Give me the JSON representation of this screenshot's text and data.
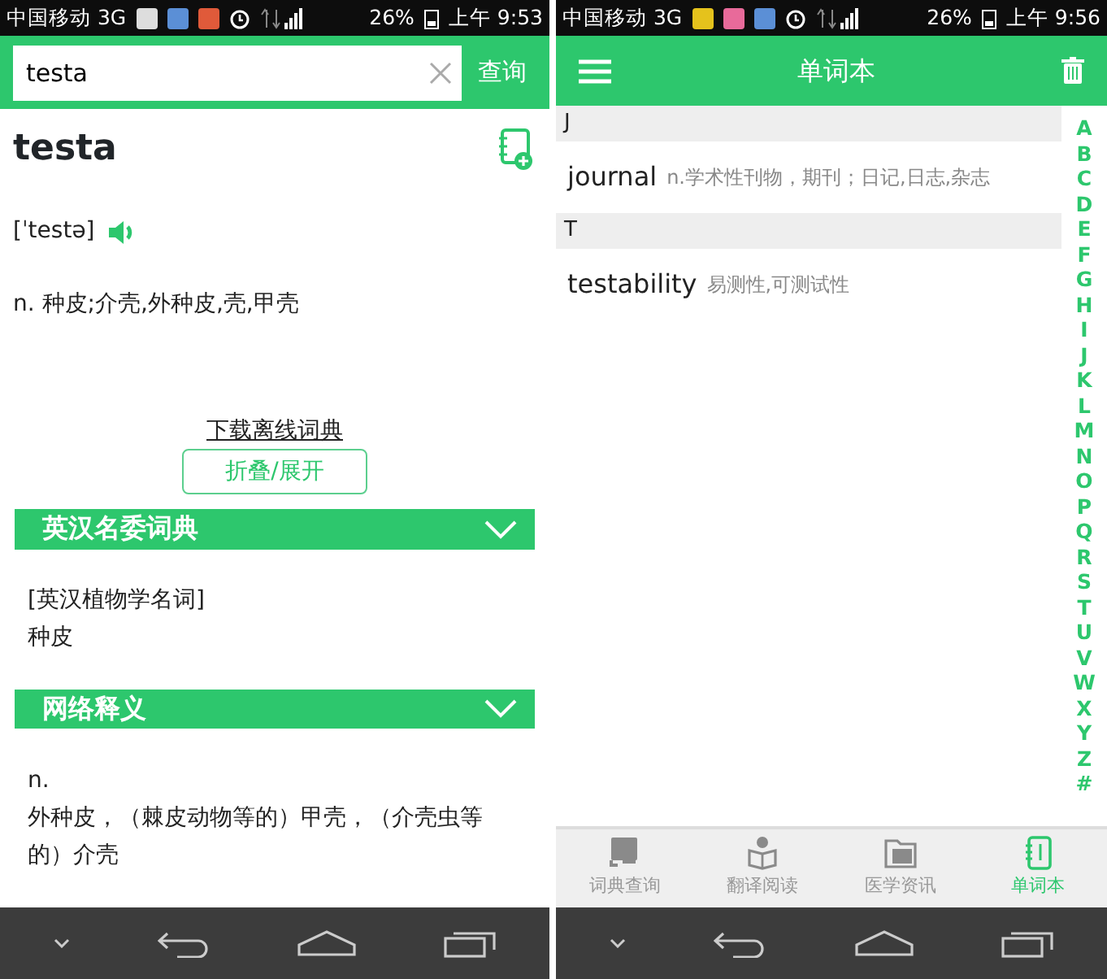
{
  "left_screen": {
    "status_bar": {
      "carrier": "中国移动 3G",
      "battery": "26%",
      "time": "上午 9:53"
    },
    "search": {
      "value": "testa",
      "button": "查询"
    },
    "word": "testa",
    "phonetic": "[ˈtestə]",
    "definition": "n. 种皮;介壳,外种皮,壳,甲壳",
    "download_link": "下载离线词典",
    "toggle_button": "折叠/展开",
    "sections": [
      {
        "title": "英汉名委词典",
        "lines": [
          "[英汉植物学名词]",
          "种皮"
        ]
      },
      {
        "title": "网络释义",
        "lines": [
          "n.",
          "外种皮，（棘皮动物等的）甲壳，（介壳虫等的）介壳"
        ]
      }
    ]
  },
  "right_screen": {
    "status_bar": {
      "carrier": "中国移动 3G",
      "battery": "26%",
      "time": "上午 9:56"
    },
    "title": "单词本",
    "groups": [
      {
        "letter": "J",
        "entries": [
          {
            "word": "journal",
            "meaning": "n.学术性刊物，期刊；日记,日志,杂志"
          }
        ]
      },
      {
        "letter": "T",
        "entries": [
          {
            "word": "testability",
            "meaning": "易测性,可测试性"
          }
        ]
      }
    ],
    "index": [
      "A",
      "B",
      "C",
      "D",
      "E",
      "F",
      "G",
      "H",
      "I",
      "J",
      "K",
      "L",
      "M",
      "N",
      "O",
      "P",
      "Q",
      "R",
      "S",
      "T",
      "U",
      "V",
      "W",
      "X",
      "Y",
      "Z",
      "#"
    ],
    "tabs": [
      {
        "label": "词典查询",
        "kind": "book",
        "selected": false
      },
      {
        "label": "翻译阅读",
        "kind": "reader",
        "selected": false
      },
      {
        "label": "医学资讯",
        "kind": "folder",
        "selected": false
      },
      {
        "label": "单词本",
        "kind": "notebook",
        "selected": true
      }
    ]
  }
}
